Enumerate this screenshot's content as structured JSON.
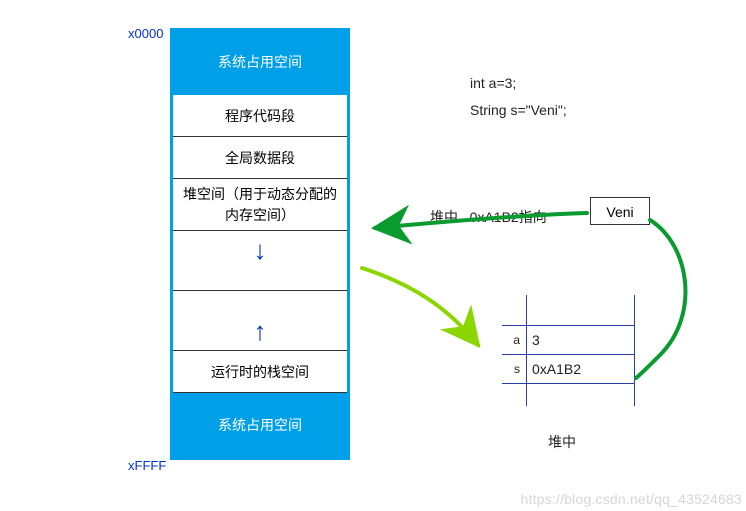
{
  "addresses": {
    "top": "x0000",
    "bottom": "xFFFF"
  },
  "memory": {
    "system_top": "系统占用空间",
    "code_segment": "程序代码段",
    "global_segment": "全局数据段",
    "heap_segment": "堆空间（用于动态分配的内存空间）",
    "stack_segment": "运行时的栈空间",
    "system_bottom": "系统占用空间"
  },
  "code": {
    "line1": "int a=3;",
    "line2": "String s=\"Veni\";"
  },
  "heap": {
    "caption_prefix": "堆中",
    "caption_pointer": "0xA1B2指向",
    "value": "Veni"
  },
  "stack": {
    "caption": "堆中",
    "rows": [
      {
        "name": "a",
        "value": "3"
      },
      {
        "name": "s",
        "value": "0xA1B2"
      }
    ]
  },
  "arrows": {
    "down": "↓",
    "up": "↑"
  },
  "watermark": "https://blog.csdn.net/qq_43524683"
}
